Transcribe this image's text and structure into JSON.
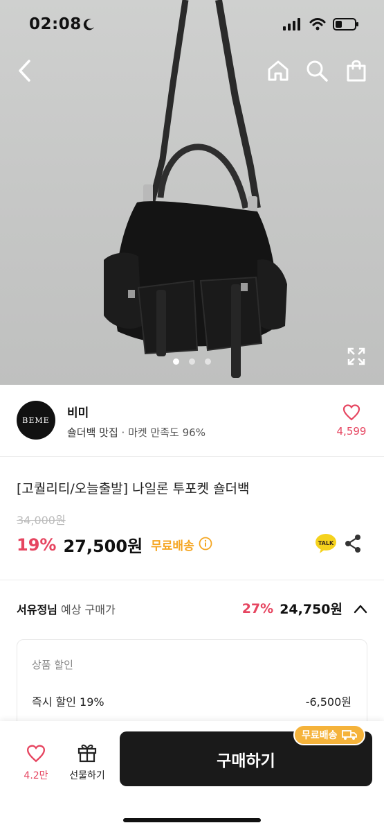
{
  "status": {
    "time": "02:08"
  },
  "hero": {
    "page_indicator": {
      "count": 3,
      "active": 1
    }
  },
  "seller": {
    "logo_text": "BEME",
    "name": "비미",
    "tagline": "숄더백 맛집",
    "satisfaction": " · 마켓 만족도 96%",
    "like_count": "4,599"
  },
  "product": {
    "title": "[고퀄리티/오늘출발] 나일론 투포켓 숄더백",
    "original_price": "34,000원",
    "discount_rate": "19%",
    "price": "27,500원",
    "free_shipping": "무료배송",
    "talk_label": "TALK"
  },
  "expected": {
    "user_name": "서유정님",
    "label": " 예상 구매가",
    "discount_rate": "27%",
    "price": "24,750원"
  },
  "discount_box": {
    "header": "상품 할인",
    "row_label": "즉시 할인 19%",
    "row_value": "-6,500원"
  },
  "bottom_bar": {
    "like_count": "4.2만",
    "gift_label": "선물하기",
    "buy_label": "구매하기",
    "shipping_badge": "무료배송"
  },
  "colors": {
    "accent_pink": "#e64560",
    "shipping_yellow": "#f5a623",
    "buy_button": "#1a1a1a"
  }
}
